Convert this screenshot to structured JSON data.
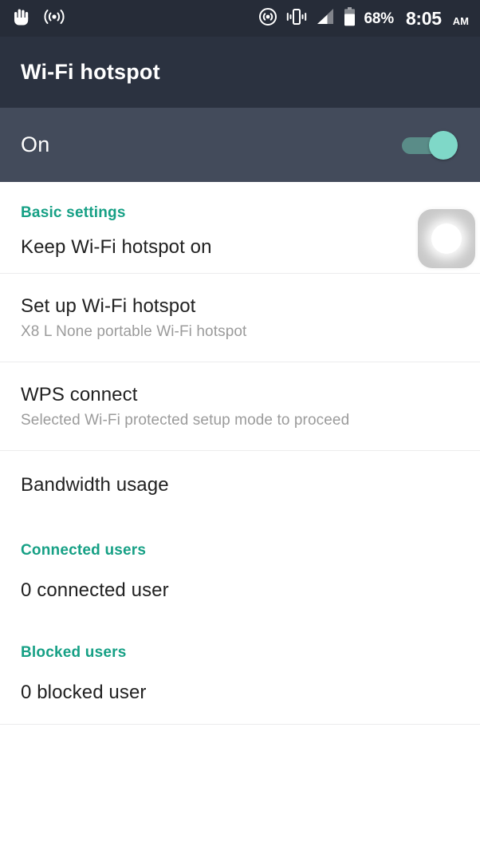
{
  "status_bar": {
    "left_icons": [
      "hand-icon",
      "broadcast-icon"
    ],
    "right_icons": [
      "hotspot-icon",
      "vibrate-icon",
      "signal-icon",
      "battery-icon"
    ],
    "battery_percent": "68%",
    "time": "8:05",
    "am_pm": "AM"
  },
  "header": {
    "title": "Wi-Fi hotspot"
  },
  "master_toggle": {
    "label": "On",
    "state": "on",
    "thumb_color": "#7fd8c8",
    "track_color": "#5a8c88"
  },
  "colors": {
    "accent": "#16a085",
    "status_bar_bg": "#262c38",
    "title_bar_bg": "#2b3240",
    "master_bar_bg": "#434b5b",
    "primary_text": "#212121",
    "secondary_text": "#9b9b9b",
    "divider": "#ececed"
  },
  "sections": {
    "basic": {
      "header": "Basic settings",
      "rows": [
        {
          "title": "Keep Wi-Fi hotspot on",
          "subtitle": ""
        },
        {
          "title": "Set up Wi-Fi hotspot",
          "subtitle": "X8 L None portable Wi-Fi hotspot"
        },
        {
          "title": "WPS connect",
          "subtitle": "Selected Wi-Fi protected setup mode to proceed"
        },
        {
          "title": "Bandwidth usage",
          "subtitle": ""
        }
      ]
    },
    "connected": {
      "header": "Connected users",
      "value": "0 connected user"
    },
    "blocked": {
      "header": "Blocked users",
      "value": "0 blocked user"
    }
  },
  "overlay": {
    "touch_indicator": "touch-pointer-indicator"
  }
}
